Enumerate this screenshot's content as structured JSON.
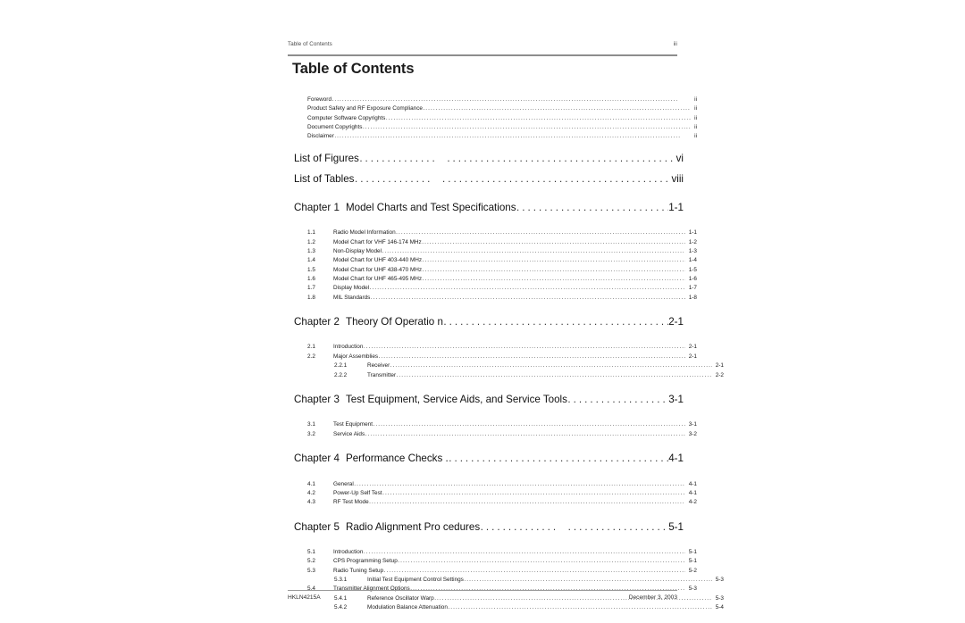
{
  "header": {
    "running_title": "Table of Contents",
    "page_number": "iii"
  },
  "title": "Table of Contents",
  "front_matter": [
    {
      "label": "Foreword",
      "page": "ii"
    },
    {
      "label": "Product Safety and RF Exposure Compliance",
      "page": "ii"
    },
    {
      "label": "Computer Software Copyrights",
      "page": "ii"
    },
    {
      "label": "Document Copyrights",
      "page": "ii"
    },
    {
      "label": "Disclaimer",
      "page": "ii"
    }
  ],
  "lists": [
    {
      "label": "List of Figures",
      "page": "vi"
    },
    {
      "label": "List of Tables",
      "page": "viii"
    }
  ],
  "chapters": [
    {
      "number": "Chapter 1",
      "title": "Model Charts and Test    Specifications",
      "page": "1-1",
      "sections": [
        {
          "num": "1.1",
          "label": "Radio Model Information",
          "page": "1-1"
        },
        {
          "num": "1.2",
          "label": "Model Chart for VHF 146-174 MHz",
          "page": "1-2"
        },
        {
          "num": "1.3",
          "label": "Non-Display Model",
          "page": "1-3"
        },
        {
          "num": "1.4",
          "label": "Model Chart for UHF 403-440 MHz",
          "page": "1-4"
        },
        {
          "num": "1.5",
          "label": "Model Chart for UHF 438-470 MHz",
          "page": "1-5"
        },
        {
          "num": "1.6",
          "label": "Model Chart for UHF 465-495 MHz",
          "page": "1-6"
        },
        {
          "num": "1.7",
          "label": "Display Model",
          "page": "1-7"
        },
        {
          "num": "1.8",
          "label": "MIL Standards",
          "page": "1-8"
        }
      ]
    },
    {
      "number": "Chapter 2",
      "title": "Theory Of Operatio   n",
      "page": "2-1",
      "sections": [
        {
          "num": "2.1",
          "label": "Introduction",
          "page": "2-1"
        },
        {
          "num": "2.2",
          "label": "Major Assemblies",
          "page": "2-1"
        },
        {
          "num": "2.2.1",
          "label": "Receiver",
          "page": "2-1",
          "sub": true
        },
        {
          "num": "2.2.2",
          "label": "Transmitter",
          "page": "2-2",
          "sub": true
        }
      ]
    },
    {
      "number": "Chapter 3",
      "title": "Test Equipment, Service    Aids, and Service Tools",
      "page": "3-1",
      "sections": [
        {
          "num": "3.1",
          "label": "Test Equipment",
          "page": "3-1"
        },
        {
          "num": "3.2",
          "label": "Service Aids",
          "page": "3-2"
        }
      ]
    },
    {
      "number": "Chapter 4",
      "title": "Performance Checks .",
      "page": "4-1",
      "sections": [
        {
          "num": "4.1",
          "label": "General",
          "page": "4-1"
        },
        {
          "num": "4.2",
          "label": "Power-Up Self Test",
          "page": "4-1"
        },
        {
          "num": "4.3",
          "label": "RF Test Mode",
          "page": "4-2"
        }
      ]
    },
    {
      "number": "Chapter 5",
      "title": "Radio Alignment Pro   cedures",
      "page": "5-1",
      "sections": [
        {
          "num": "5.1",
          "label": "Introduction",
          "page": "5-1"
        },
        {
          "num": "5.2",
          "label": "CPS Programming Setup",
          "page": "5-1"
        },
        {
          "num": "5.3",
          "label": "Radio Tuning Setup",
          "page": "5-2"
        },
        {
          "num": "5.3.1",
          "label": "Initial Test Equipment Control Settings",
          "page": "5-3",
          "sub": true
        },
        {
          "num": "5.4",
          "label": "Transmitter Alignment Options",
          "page": "5-3"
        },
        {
          "num": "5.4.1",
          "label": "Reference Oscillator Warp",
          "page": "5-3",
          "sub": true
        },
        {
          "num": "5.4.2",
          "label": "Modulation Balance Attenuation",
          "page": "5-4",
          "sub": true
        }
      ]
    }
  ],
  "footer": {
    "document_id": "HKLN4215A",
    "date": "December 3, 2003"
  }
}
